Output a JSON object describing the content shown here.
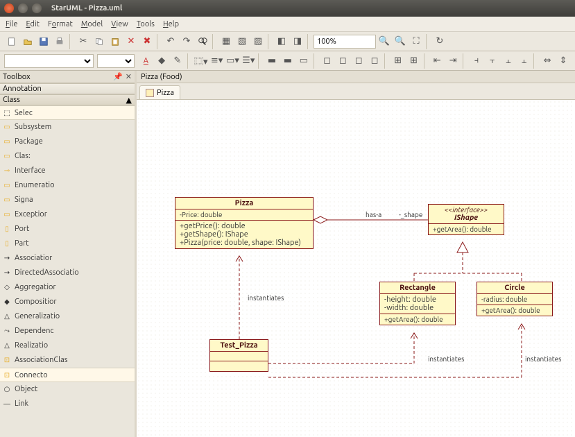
{
  "window": {
    "title": "StarUML - Pizza.uml"
  },
  "menu": {
    "file": "File",
    "edit": "Edit",
    "format": "Format",
    "model": "Model",
    "view": "View",
    "tools": "Tools",
    "help": "Help"
  },
  "zoom": "100%",
  "sidebar": {
    "title": "Toolbox",
    "sections": {
      "annotation": "Annotation",
      "class": "Class"
    },
    "tools": [
      "Selec",
      "Subsystem",
      "Package",
      "Clas:",
      "Interface",
      "Enumeratio",
      "Signa",
      "Exceptior",
      "Port",
      "Part",
      "Associatior",
      "DirectedAssociatio",
      "Aggregatior",
      "Compositior",
      "Generalizatio",
      "Dependenc",
      "Realizatio",
      "AssociationClas",
      "Connecto",
      "Object",
      "Link"
    ]
  },
  "breadcrumb": "Pizza (Food)",
  "tab": "Pizza",
  "uml": {
    "pizza": {
      "name": "Pizza",
      "attr": "-Price: double",
      "ops": [
        "+getPrice(): double",
        "+getShape(): IShape",
        "+Pizza(price: double, shape: IShape)"
      ]
    },
    "ishape": {
      "stereo": "<<interface>>",
      "name": "IShape",
      "op": "+getArea(): double"
    },
    "rect": {
      "name": "Rectangle",
      "attrs": [
        "-height: double",
        "-width: double"
      ],
      "op": "+getArea(): double"
    },
    "circle": {
      "name": "Circle",
      "attr": "-radius: double",
      "op": "+getArea(): double"
    },
    "test": {
      "name": "Test_Pizza"
    },
    "rel": {
      "hasa": "has-a",
      "shape": "-_shape",
      "inst": "instantiates"
    }
  }
}
